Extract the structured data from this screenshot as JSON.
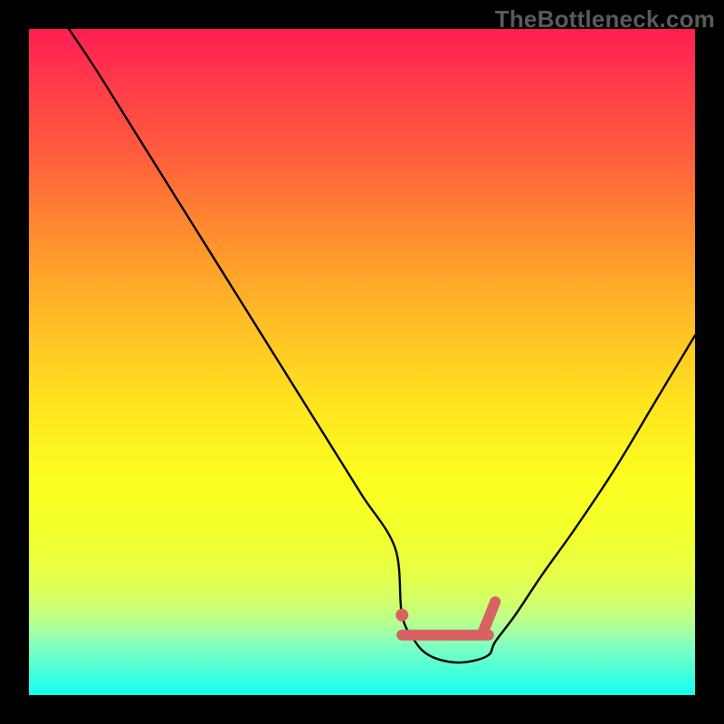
{
  "brand": "TheBottleneck.com",
  "chart_data": {
    "type": "line",
    "title": "",
    "xlabel": "",
    "ylabel": "",
    "xlim": [
      0,
      100
    ],
    "ylim": [
      0,
      100
    ],
    "grid": false,
    "legend": false,
    "series": [
      {
        "name": "bottleneck-curve",
        "x": [
          6,
          10,
          15,
          20,
          25,
          30,
          35,
          40,
          45,
          50,
          55,
          56,
          58,
          60,
          63,
          66,
          69,
          70,
          73,
          77,
          82,
          88,
          94,
          100
        ],
        "y": [
          100,
          94,
          86,
          78,
          70,
          62,
          54,
          46,
          38,
          30,
          22,
          12,
          8,
          6,
          5,
          5,
          6,
          8,
          12,
          18,
          25,
          34,
          44,
          54
        ]
      }
    ],
    "trough_markers": {
      "dot": {
        "x": 56,
        "y": 12
      },
      "bar": {
        "x0": 56,
        "y0": 9,
        "x1": 69,
        "y1": 9
      },
      "bar2": {
        "x0": 68,
        "y0": 9,
        "x1": 70,
        "y1": 14
      }
    },
    "colors": {
      "curve": "#000000",
      "marker": "#d86262"
    }
  }
}
